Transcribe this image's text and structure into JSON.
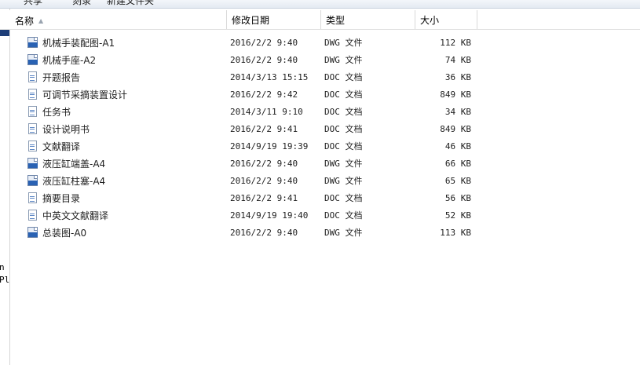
{
  "toolbar": {
    "items": [
      "共享",
      "刻录",
      "新建文件夹"
    ]
  },
  "nav": {
    "fragments": [
      "n",
      "Plu"
    ]
  },
  "columns": {
    "name": "名称",
    "date": "修改日期",
    "type": "类型",
    "size": "大小"
  },
  "files": [
    {
      "name": "机械手装配图-A1",
      "date": "2016/2/2 9:40",
      "type": "DWG 文件",
      "size": "112 KB",
      "icon": "dwg-file-icon"
    },
    {
      "name": "机械手座-A2",
      "date": "2016/2/2 9:40",
      "type": "DWG 文件",
      "size": "74 KB",
      "icon": "dwg-file-icon"
    },
    {
      "name": "开题报告",
      "date": "2014/3/13 15:15",
      "type": "DOC 文档",
      "size": "36 KB",
      "icon": "doc-file-icon"
    },
    {
      "name": "可调节采摘装置设计",
      "date": "2016/2/2 9:42",
      "type": "DOC 文档",
      "size": "849 KB",
      "icon": "doc-file-icon"
    },
    {
      "name": "任务书",
      "date": "2014/3/11 9:10",
      "type": "DOC 文档",
      "size": "34 KB",
      "icon": "doc-file-icon"
    },
    {
      "name": "设计说明书",
      "date": "2016/2/2 9:41",
      "type": "DOC 文档",
      "size": "849 KB",
      "icon": "doc-file-icon"
    },
    {
      "name": "文献翻译",
      "date": "2014/9/19 19:39",
      "type": "DOC 文档",
      "size": "46 KB",
      "icon": "doc-file-icon"
    },
    {
      "name": "液压缸端盖-A4",
      "date": "2016/2/2 9:40",
      "type": "DWG 文件",
      "size": "66 KB",
      "icon": "dwg-file-icon"
    },
    {
      "name": "液压缸柱塞-A4",
      "date": "2016/2/2 9:40",
      "type": "DWG 文件",
      "size": "65 KB",
      "icon": "dwg-file-icon"
    },
    {
      "name": "摘要目录",
      "date": "2016/2/2 9:41",
      "type": "DOC 文档",
      "size": "56 KB",
      "icon": "doc-file-icon"
    },
    {
      "name": "中英文文献翻译",
      "date": "2014/9/19 19:40",
      "type": "DOC 文档",
      "size": "52 KB",
      "icon": "doc-file-icon"
    },
    {
      "name": "总装图-A0",
      "date": "2016/2/2 9:40",
      "type": "DWG 文件",
      "size": "113 KB",
      "icon": "dwg-file-icon"
    }
  ]
}
